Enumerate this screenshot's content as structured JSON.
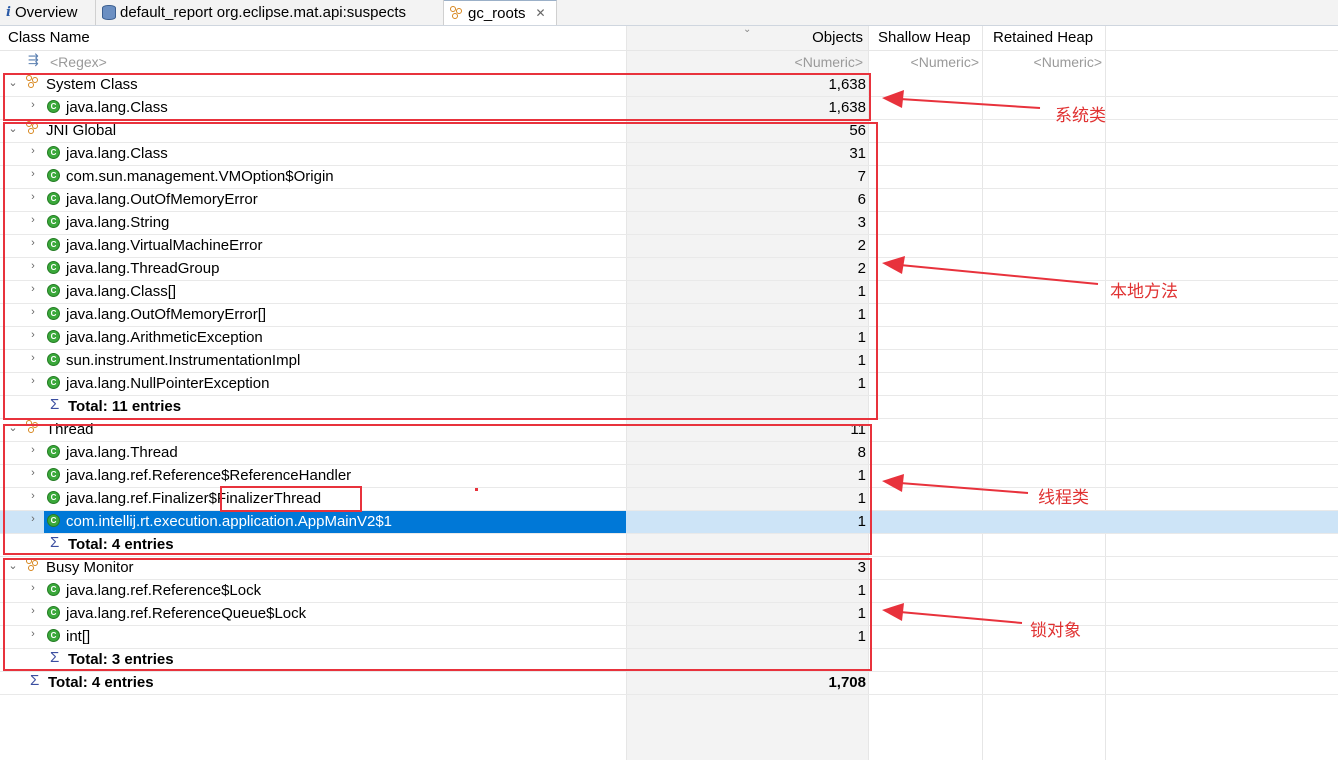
{
  "tabs": [
    {
      "label": "Overview",
      "icon": "info-icon"
    },
    {
      "label": "default_report  org.eclipse.mat.api:suspects",
      "icon": "report-icon"
    },
    {
      "label": "gc_roots",
      "icon": "gc-roots-icon",
      "active": true
    }
  ],
  "columns": {
    "class_name": "Class Name",
    "objects": "Objects",
    "shallow_heap": "Shallow Heap",
    "retained_heap": "Retained Heap"
  },
  "filters": {
    "class_name": "<Regex>",
    "objects": "<Numeric>",
    "shallow_heap": "<Numeric>",
    "retained_heap": "<Numeric>"
  },
  "rows": [
    {
      "kind": "group",
      "label": "System Class",
      "objects": "1,638"
    },
    {
      "kind": "class",
      "label": "java.lang.Class",
      "objects": "1,638"
    },
    {
      "kind": "group",
      "label": "JNI Global",
      "objects": "56"
    },
    {
      "kind": "class",
      "label": "java.lang.Class",
      "objects": "31"
    },
    {
      "kind": "class",
      "label": "com.sun.management.VMOption$Origin",
      "objects": "7"
    },
    {
      "kind": "class",
      "label": "java.lang.OutOfMemoryError",
      "objects": "6"
    },
    {
      "kind": "class",
      "label": "java.lang.String",
      "objects": "3"
    },
    {
      "kind": "class",
      "label": "java.lang.VirtualMachineError",
      "objects": "2"
    },
    {
      "kind": "class",
      "label": "java.lang.ThreadGroup",
      "objects": "2"
    },
    {
      "kind": "class",
      "label": "java.lang.Class[]",
      "objects": "1"
    },
    {
      "kind": "class",
      "label": "java.lang.OutOfMemoryError[]",
      "objects": "1"
    },
    {
      "kind": "class",
      "label": "java.lang.ArithmeticException",
      "objects": "1"
    },
    {
      "kind": "class",
      "label": "sun.instrument.InstrumentationImpl",
      "objects": "1"
    },
    {
      "kind": "class",
      "label": "java.lang.NullPointerException",
      "objects": "1"
    },
    {
      "kind": "total",
      "label": "Total: 11 entries",
      "objects": ""
    },
    {
      "kind": "group",
      "label": "Thread",
      "objects": "11"
    },
    {
      "kind": "class",
      "label": "java.lang.Thread",
      "objects": "8"
    },
    {
      "kind": "class",
      "label": "java.lang.ref.Reference$ReferenceHandler",
      "objects": "1"
    },
    {
      "kind": "class",
      "label": "java.lang.ref.Finalizer$FinalizerThread",
      "objects": "1"
    },
    {
      "kind": "class",
      "label": "com.intellij.rt.execution.application.AppMainV2$1",
      "objects": "1",
      "selected": true
    },
    {
      "kind": "total",
      "label": "Total: 4 entries",
      "objects": ""
    },
    {
      "kind": "group",
      "label": "Busy Monitor",
      "objects": "3"
    },
    {
      "kind": "class",
      "label": "java.lang.ref.Reference$Lock",
      "objects": "1"
    },
    {
      "kind": "class",
      "label": "java.lang.ref.ReferenceQueue$Lock",
      "objects": "1"
    },
    {
      "kind": "class",
      "label": "int[]",
      "objects": "1"
    },
    {
      "kind": "total",
      "label": "Total: 3 entries",
      "objects": ""
    },
    {
      "kind": "grandtotal",
      "label": "Total: 4 entries",
      "objects": "1,708"
    }
  ],
  "annotations": {
    "system_class": "系统类",
    "jni": "本地方法",
    "thread": "线程类",
    "monitor": "锁对象"
  },
  "colors": {
    "selection": "#0078d7",
    "annotation_red": "#e8323c",
    "class_icon_green": "#3aa83a",
    "group_icon_orange": "#d7861d"
  }
}
